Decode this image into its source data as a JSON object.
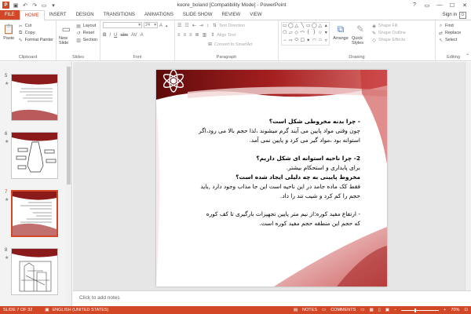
{
  "window": {
    "title": "koore_boland [Compatibility Mode] - PowerPoint",
    "help": "?",
    "minimize": "—",
    "maximize": "☐",
    "close": "✕"
  },
  "tabs": [
    {
      "label": "FILE"
    },
    {
      "label": "HOME"
    },
    {
      "label": "INSERT"
    },
    {
      "label": "DESIGN"
    },
    {
      "label": "TRANSITIONS"
    },
    {
      "label": "ANIMATIONS"
    },
    {
      "label": "SLIDE SHOW"
    },
    {
      "label": "REVIEW"
    },
    {
      "label": "VIEW"
    }
  ],
  "signin": "Sign in",
  "ribbon": {
    "clipboard": {
      "label": "Clipboard",
      "paste": "Paste",
      "cut": "Cut",
      "copy": "Copy",
      "format_painter": "Format Painter"
    },
    "slides": {
      "label": "Slides",
      "new_slide": "New Slide",
      "layout": "Layout",
      "reset": "Reset",
      "section": "Section"
    },
    "font": {
      "label": "Font",
      "size": "24"
    },
    "paragraph": {
      "label": "Paragraph",
      "text_direction": "Text Direction",
      "align_text": "Align Text",
      "convert_smartart": "Convert to SmartArt"
    },
    "drawing": {
      "label": "Drawing",
      "arrange": "Arrange",
      "quick_styles": "Quick Styles",
      "shape_fill": "Shape Fill",
      "shape_outline": "Shape Outline",
      "shape_effects": "Shape Effects"
    },
    "editing": {
      "label": "Editing",
      "find": "Find",
      "replace": "Replace",
      "select": "Select"
    }
  },
  "thumbnails": [
    {
      "number": "5"
    },
    {
      "number": "6"
    },
    {
      "number": "7"
    },
    {
      "number": "8"
    }
  ],
  "slide": {
    "lines": [
      "- چرا بدنه مخروطی شکل است؟",
      "چون وقتی مواد پایین می آیند گرم میشوند ،لذا حجم بالا می رود،اگر",
      "استوانه بود ،مواد گیر می کرد و پایین نمی آمد.",
      "2- چرا ناحیه استوانه ای شکل داریم؟",
      "برای پایداری و استحکام بیشتر.",
      "مخروط پایینی به چه دلیلی ایجاد شده است؟",
      "فقط کک ماده جامد در این ناحیه است این جا مذاب وجود دارد ,باید",
      "حجم را کم کرد و شیب تند را داد.",
      "- ارتفاع مفید کوره:از نیم متر پایین تجهیزات بارگیری تا کف کوره",
      "که حجم این منطقه حجم مفید کوره است."
    ]
  },
  "notes_placeholder": "Click to add notes",
  "status": {
    "slide_info": "SLIDE 7 OF 32",
    "language": "ENGLISH (UNITED STATES)",
    "notes": "NOTES",
    "comments": "COMMENTS",
    "zoom_minus": "−",
    "zoom_plus": "+",
    "zoom": "70%",
    "zoom_fraction": 0.7
  }
}
